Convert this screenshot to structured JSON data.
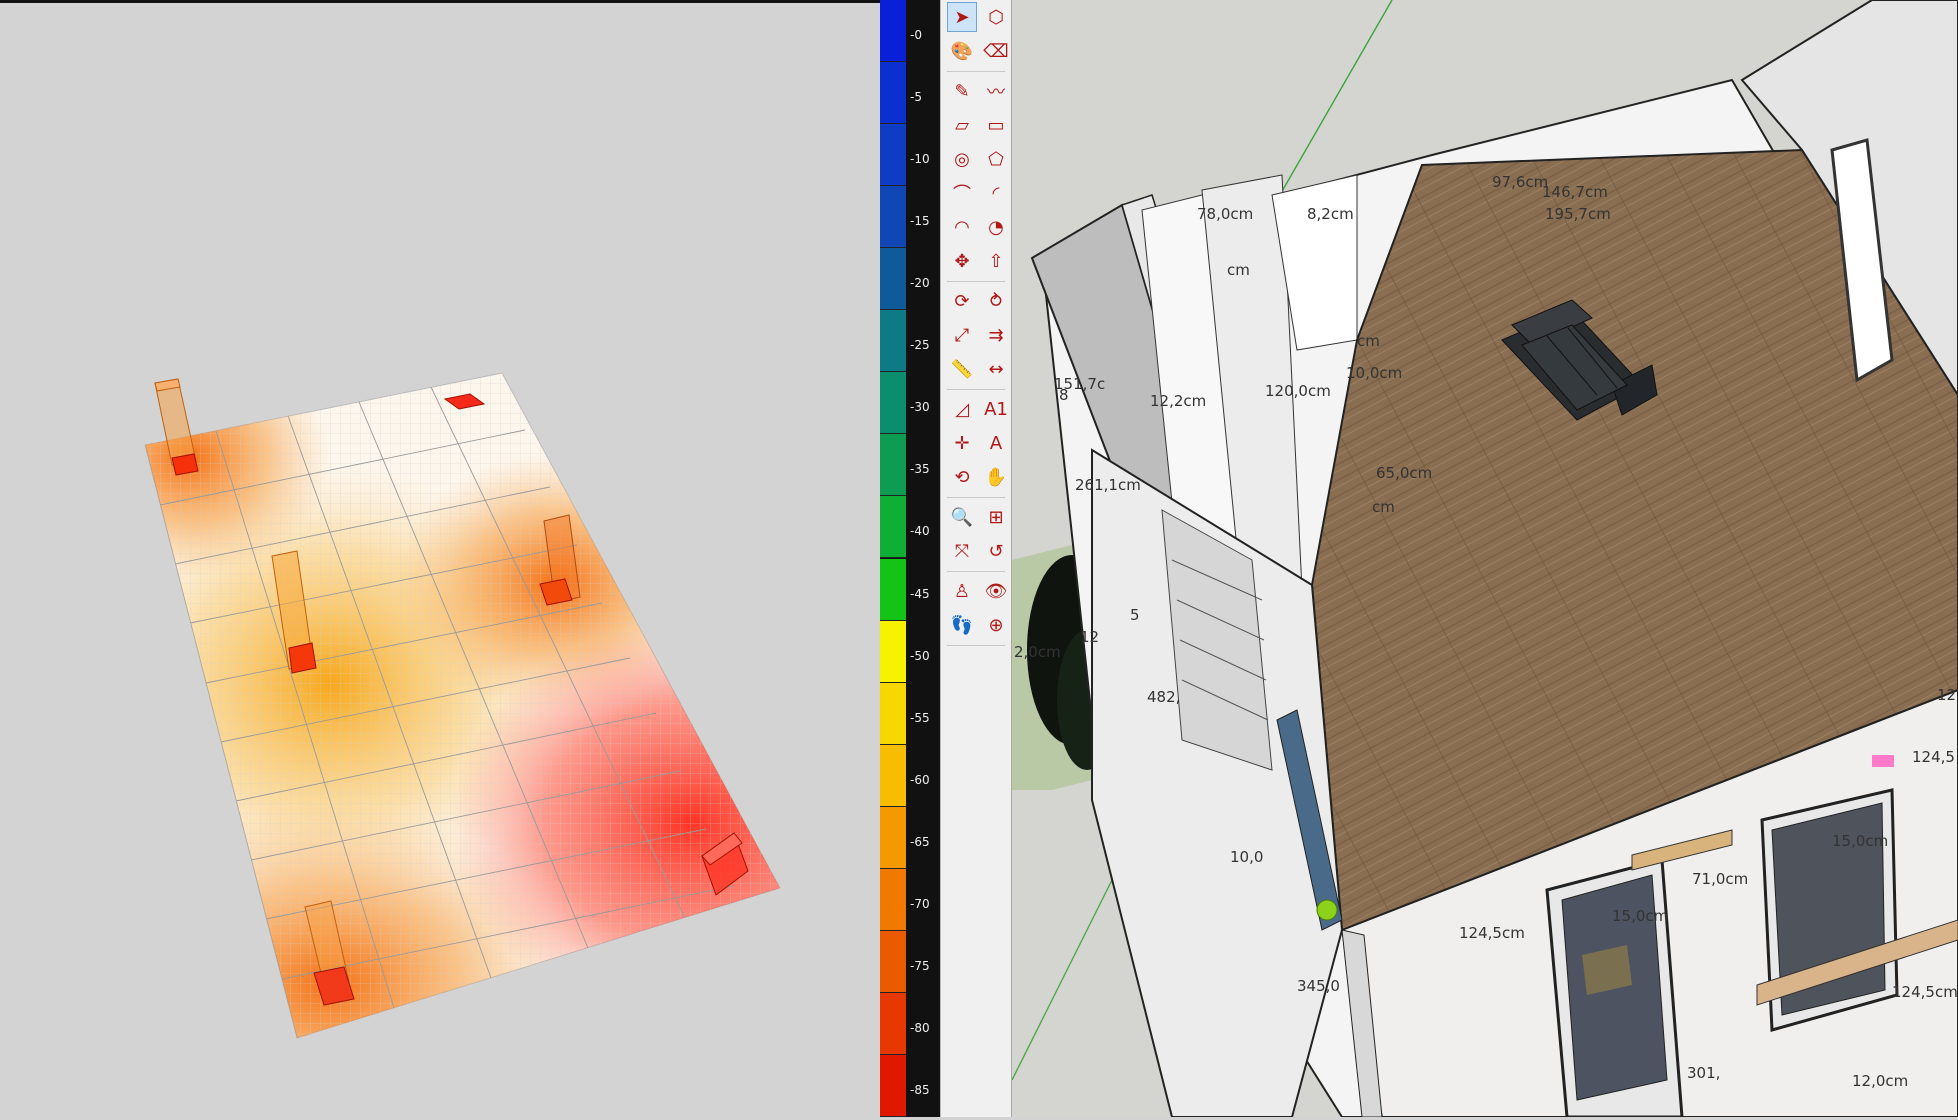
{
  "legend": {
    "labels": [
      "-0",
      "-5",
      "-10",
      "-15",
      "-20",
      "-25",
      "-30",
      "-35",
      "-40",
      "-45",
      "-50",
      "-55",
      "-60",
      "-65",
      "-70",
      "-75",
      "-80",
      "-85"
    ],
    "colors": [
      "#0a1fd8",
      "#0c2fd0",
      "#0f3cc4",
      "#1046b5",
      "#0f5b9a",
      "#0d7a86",
      "#0b8e6e",
      "#0e9c52",
      "#0fae35",
      "#13c316",
      "#f7f200",
      "#f7d700",
      "#f7bd00",
      "#f49a00",
      "#f07a00",
      "#ea5a00",
      "#e63800",
      "#e01800"
    ]
  },
  "heatmap": {
    "colors": {
      "hot": "#ff3b2f",
      "warm": "#f7941d",
      "light": "#ffd9a0"
    },
    "access_points": [
      "ap-1",
      "ap-2",
      "ap-3",
      "ap-4",
      "ap-5",
      "ap-6"
    ]
  },
  "toolbar": {
    "tools": [
      {
        "name": "select-tool",
        "icon": "arrow-icon",
        "glyph": "➤"
      },
      {
        "name": "component-tool",
        "icon": "cube-icon",
        "glyph": "⬡"
      },
      {
        "name": "paint-bucket-tool",
        "icon": "paint-bucket-icon",
        "glyph": "🎨"
      },
      {
        "name": "eraser-tool",
        "icon": "eraser-icon",
        "glyph": "⌫"
      },
      {
        "name": "line-tool",
        "icon": "pencil-icon",
        "glyph": "✎"
      },
      {
        "name": "freehand-tool",
        "icon": "freehand-icon",
        "glyph": "〰"
      },
      {
        "name": "rectangle-tool",
        "icon": "rectangle-icon",
        "glyph": "▱"
      },
      {
        "name": "rotated-rectangle-tool",
        "icon": "rotated-rectangle-icon",
        "glyph": "▭"
      },
      {
        "name": "circle-tool",
        "icon": "circle-icon",
        "glyph": "◎"
      },
      {
        "name": "polygon-tool",
        "icon": "polygon-icon",
        "glyph": "⬠"
      },
      {
        "name": "arc-tool",
        "icon": "arc-icon",
        "glyph": "⌒"
      },
      {
        "name": "two-point-arc-tool",
        "icon": "two-point-arc-icon",
        "glyph": "◜"
      },
      {
        "name": "three-point-arc-tool",
        "icon": "three-point-arc-icon",
        "glyph": "◠"
      },
      {
        "name": "pie-tool",
        "icon": "pie-icon",
        "glyph": "◔"
      },
      {
        "name": "move-tool",
        "icon": "move-icon",
        "glyph": "✥"
      },
      {
        "name": "push-pull-tool",
        "icon": "push-pull-icon",
        "glyph": "⇧"
      },
      {
        "name": "rotate-tool",
        "icon": "rotate-icon",
        "glyph": "⟳"
      },
      {
        "name": "follow-me-tool",
        "icon": "follow-me-icon",
        "glyph": "⥁"
      },
      {
        "name": "scale-tool",
        "icon": "scale-icon",
        "glyph": "⤢"
      },
      {
        "name": "offset-tool",
        "icon": "offset-icon",
        "glyph": "⇉"
      },
      {
        "name": "tape-measure-tool",
        "icon": "tape-measure-icon",
        "glyph": "📏"
      },
      {
        "name": "dimension-tool",
        "icon": "dimension-icon",
        "glyph": "↔"
      },
      {
        "name": "protractor-tool",
        "icon": "protractor-icon",
        "glyph": "◿"
      },
      {
        "name": "text-tool",
        "icon": "text-icon",
        "glyph": "A1"
      },
      {
        "name": "axes-tool",
        "icon": "axes-icon",
        "glyph": "✛"
      },
      {
        "name": "3d-text-tool",
        "icon": "3d-text-icon",
        "glyph": "A"
      },
      {
        "name": "orbit-tool",
        "icon": "orbit-icon",
        "glyph": "⟲"
      },
      {
        "name": "pan-tool",
        "icon": "hand-icon",
        "glyph": "✋"
      },
      {
        "name": "zoom-tool",
        "icon": "magnifier-icon",
        "glyph": "🔍"
      },
      {
        "name": "zoom-window-tool",
        "icon": "zoom-window-icon",
        "glyph": "⊞"
      },
      {
        "name": "zoom-extents-tool",
        "icon": "zoom-extents-icon",
        "glyph": "⤧"
      },
      {
        "name": "previous-view-tool",
        "icon": "previous-view-icon",
        "glyph": "↺"
      },
      {
        "name": "position-camera-tool",
        "icon": "camera-position-icon",
        "glyph": "♙"
      },
      {
        "name": "look-around-tool",
        "icon": "eye-icon",
        "glyph": "👁"
      },
      {
        "name": "walk-tool",
        "icon": "footprints-icon",
        "glyph": "👣"
      },
      {
        "name": "section-plane-tool",
        "icon": "section-plane-icon",
        "glyph": "⊕"
      }
    ]
  },
  "model": {
    "dimensions": [
      "97,6cm",
      "146,7cm",
      "195,7cm",
      "78,0cm",
      "8,2cm",
      "cm",
      "120,0cm",
      "12,2cm",
      "10,0cm",
      "cm",
      "151,7c",
      "8",
      "65,0cm",
      "261,1cm",
      "cm",
      "5",
      "12",
      "2,0cm",
      "482,",
      "10,0",
      "124,5cm",
      "71,0cm",
      "15,0cm",
      "15,0cm",
      "345,0",
      "124,5cm",
      "124,5",
      "12",
      "301,",
      "12,0cm"
    ]
  }
}
